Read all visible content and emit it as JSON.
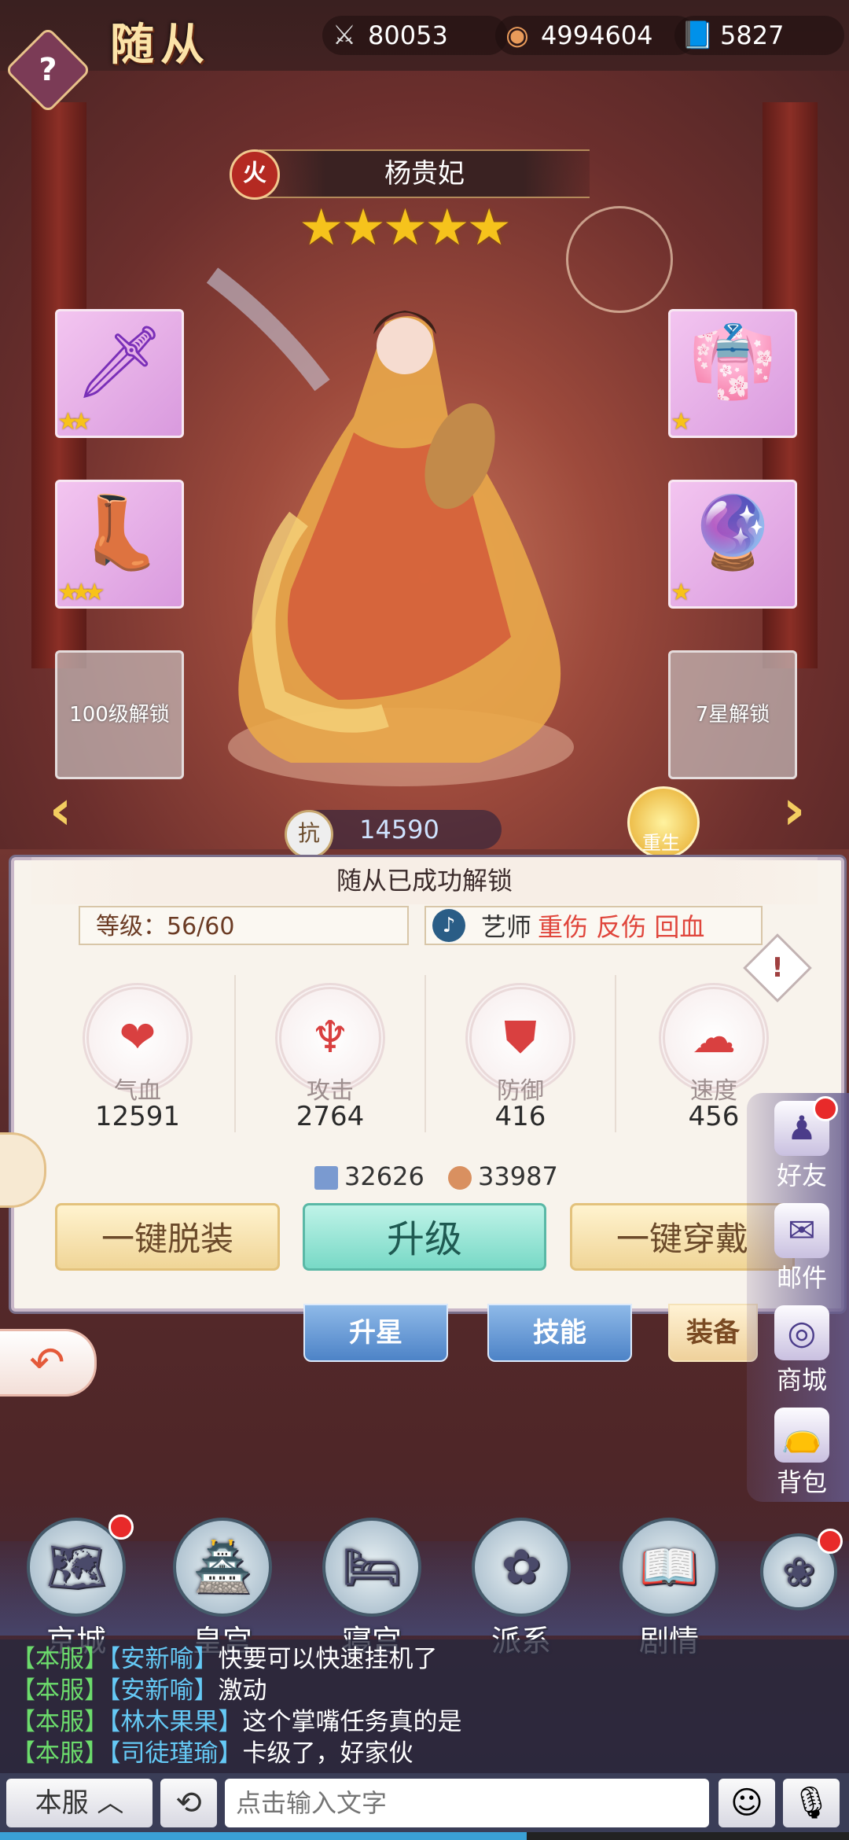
{
  "header": {
    "title": "随从",
    "help_label": "?",
    "resources": [
      {
        "icon": "crossed-swords-icon",
        "glyph": "⚔",
        "value": "80053"
      },
      {
        "icon": "coin-icon",
        "glyph": "◉",
        "value": "4994604"
      },
      {
        "icon": "book-icon",
        "glyph": "📘",
        "value": "5827"
      }
    ]
  },
  "hero": {
    "element": "火",
    "name": "杨贵妃",
    "stars": "★★★★★",
    "star_count": 5,
    "power": "14590",
    "power_prefix": "抗",
    "rebirth_label": "重生",
    "equip_slots": [
      {
        "icon": "sword-icon",
        "glyph": "🗡",
        "stars": "★★"
      },
      {
        "icon": "robe-icon",
        "glyph": "👘",
        "stars": "★"
      },
      {
        "icon": "boots-icon",
        "glyph": "👢",
        "stars": "★★★"
      },
      {
        "icon": "pendant-icon",
        "glyph": "🔮",
        "stars": "★"
      }
    ],
    "locked_slots": [
      "100级解锁",
      "7星解锁"
    ]
  },
  "panel": {
    "unlock_text": "随从已成功解锁",
    "level": "等级：56/60",
    "role": "艺师",
    "role_tags": "重伤 反伤 回血",
    "stats": [
      {
        "icon": "heart-icon",
        "glyph": "❤",
        "label": "气血",
        "value": "12591"
      },
      {
        "icon": "trident-icon",
        "glyph": "♆",
        "label": "攻击",
        "value": "2764"
      },
      {
        "icon": "shield-icon",
        "glyph": "⛊",
        "label": "防御",
        "value": "416"
      },
      {
        "icon": "cloud-icon",
        "glyph": "☁",
        "label": "速度",
        "value": "456"
      }
    ],
    "currency": [
      {
        "icon": "scroll-icon",
        "value": "32626"
      },
      {
        "icon": "coin-icon",
        "value": "33987"
      }
    ],
    "buttons": {
      "unequip_all": "一键脱装",
      "upgrade": "升级",
      "equip_all": "一键穿戴"
    }
  },
  "tabs": [
    "升星",
    "技能",
    "装备"
  ],
  "side_menu": [
    {
      "icon": "friends-icon",
      "glyph": "♟",
      "label": "好友",
      "badge": true
    },
    {
      "icon": "mail-icon",
      "glyph": "✉",
      "label": "邮件",
      "badge": false
    },
    {
      "icon": "shop-icon",
      "glyph": "◎",
      "label": "商城",
      "badge": false
    },
    {
      "icon": "bag-icon",
      "glyph": "👝",
      "label": "背包",
      "badge": false
    }
  ],
  "bottom_nav": [
    {
      "icon": "map-icon",
      "glyph": "🗺",
      "label": "京城",
      "badge": true
    },
    {
      "icon": "palace-icon",
      "glyph": "🏯",
      "label": "皇宫",
      "badge": false
    },
    {
      "icon": "bedchamber-icon",
      "glyph": "🛏",
      "label": "寝宫",
      "badge": false
    },
    {
      "icon": "lotus-icon",
      "glyph": "✿",
      "label": "派系",
      "badge": false
    },
    {
      "icon": "story-book-icon",
      "glyph": "📖",
      "label": "剧情",
      "badge": false
    },
    {
      "icon": "flower-menu-icon",
      "glyph": "❀",
      "label": "",
      "badge": true
    }
  ],
  "chat": {
    "messages": [
      {
        "channel": "【本服】",
        "name": "【安新喻】",
        "text": "快要可以快速挂机了"
      },
      {
        "channel": "【本服】",
        "name": "【安新喻】",
        "text": "激动"
      },
      {
        "channel": "【本服】",
        "name": "【林木果果】",
        "text": "这个掌嘴任务真的是"
      },
      {
        "channel": "【本服】",
        "name": "【司徒瑾瑜】",
        "text": "卡级了，好家伙"
      }
    ],
    "server_button": "本服 ︿",
    "input_placeholder": "点击输入文字"
  },
  "colors": {
    "accent": "#f3cd60",
    "panel": "#f8f3ec",
    "upgrade": "#78d9c6",
    "badge": "#e82a2a"
  }
}
